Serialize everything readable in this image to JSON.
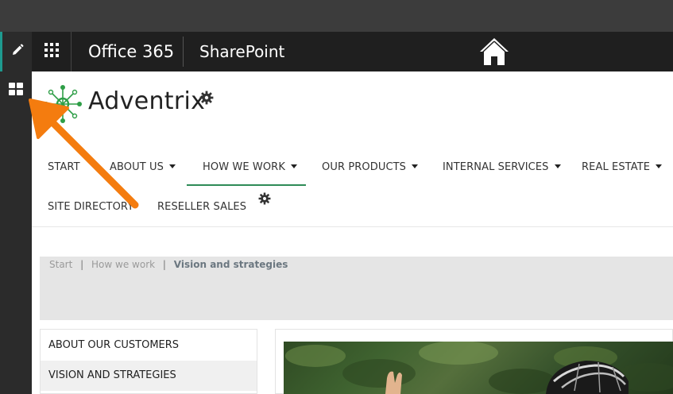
{
  "suite_bar": {
    "brand": "Office 365",
    "app": "SharePoint",
    "colors": {
      "background": "#1f1f1f",
      "accent": "#1e9a8f"
    }
  },
  "icons": {
    "edit": "pencil-icon",
    "waffle": "app-launcher-icon",
    "home": "home-icon",
    "rail": "grid-icon",
    "settings": "gear-icon",
    "logo": "network-node-icon"
  },
  "site": {
    "title": "Adventrix",
    "brand_color": "#2e9e47"
  },
  "nav": {
    "items": [
      {
        "label": "START",
        "has_dropdown": false
      },
      {
        "label": "ABOUT US",
        "has_dropdown": true
      },
      {
        "label": "HOW WE WORK",
        "has_dropdown": true,
        "active": true
      },
      {
        "label": "OUR PRODUCTS",
        "has_dropdown": true
      },
      {
        "label": "INTERNAL SERVICES",
        "has_dropdown": true
      },
      {
        "label": "REAL ESTATE",
        "has_dropdown": true
      },
      {
        "label": "SITE DIRECTORY",
        "has_dropdown": false
      },
      {
        "label": "RESELLER SALES",
        "has_dropdown": false
      }
    ],
    "active_color": "#2e8b57"
  },
  "breadcrumb": {
    "items": [
      "Start",
      "How we work"
    ],
    "separator": "|",
    "current": "Vision and strategies"
  },
  "side_menu": {
    "items": [
      "ABOUT OUR CUSTOMERS",
      "VISION AND STRATEGIES"
    ],
    "active_index": 1
  },
  "annotation": {
    "arrow_color": "#f47c0f"
  }
}
